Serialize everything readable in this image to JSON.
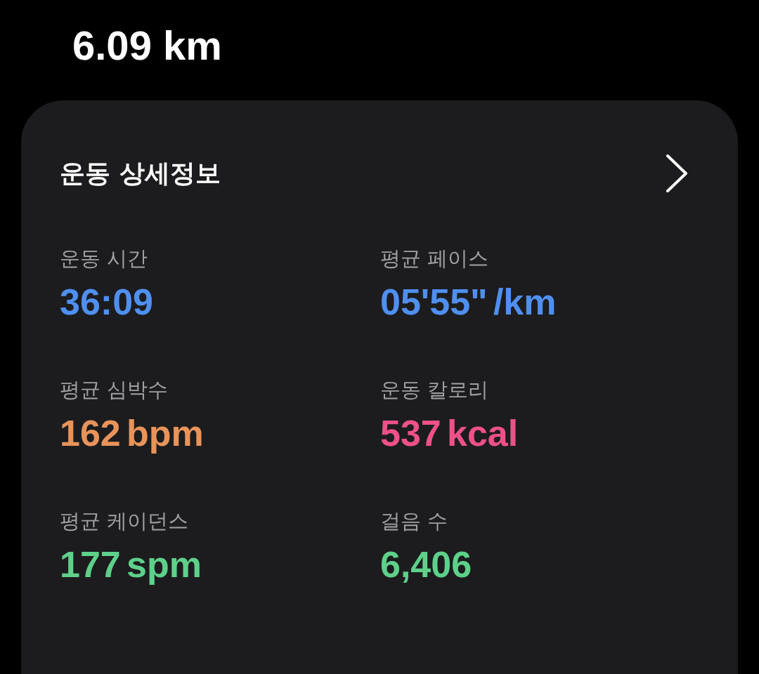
{
  "distance": "6.09 km",
  "card": {
    "title": "운동 상세정보",
    "metrics": [
      {
        "label": "운동 시간",
        "value": "36:09",
        "color": "#4f8ff0"
      },
      {
        "label": "평균 페이스",
        "value": "05'55\" /km",
        "color": "#4f8ff0"
      },
      {
        "label": "평균 심박수",
        "value": "162 bpm",
        "color": "#e8935a"
      },
      {
        "label": "운동 칼로리",
        "value": "537 kcal",
        "color": "#f0508a"
      },
      {
        "label": "평균 케이던스",
        "value": "177 spm",
        "color": "#5ed08a"
      },
      {
        "label": "걸음 수",
        "value": "6,406",
        "color": "#5ed08a"
      }
    ]
  }
}
